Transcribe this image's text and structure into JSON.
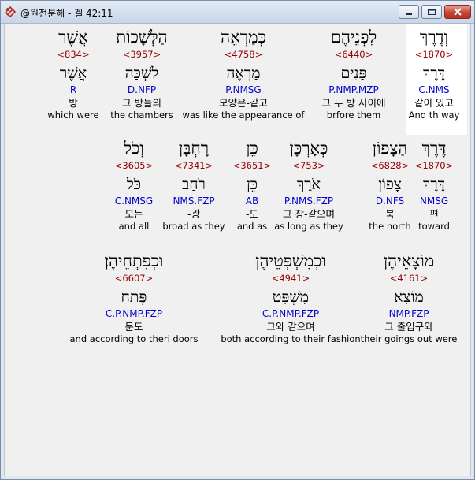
{
  "window": {
    "title": "@원전분해 - 겔 42:11",
    "colors": {
      "strong_number": "#990000",
      "morphology": "#0000cc",
      "highlight_bg": "#ffffff",
      "client_bg": "#f0f0f0"
    },
    "icons": [
      "app-icon",
      "minimize-icon",
      "maximize-icon",
      "close-icon"
    ]
  },
  "rows": [
    {
      "words": [
        {
          "hebrew": "וְדֶרֶךְ",
          "strong": "<1870>",
          "lemma": "דֶּרֶךְ",
          "morph": "C.NMS",
          "korean": "같이 있고",
          "english": "And th way",
          "highlighted": true
        },
        {
          "hebrew": "לִפְנֵיהֶם",
          "strong": "<6440>",
          "lemma": "פָּנִים",
          "morph": "P.NMP.MZP",
          "korean": "그 두 방 사이에",
          "english": "brfore them"
        },
        {
          "hebrew": "כְּמַרְאֵה",
          "strong": "<4758>",
          "lemma": "מַרְאֶה",
          "morph": "P.NMSG",
          "korean": "모양은-같고",
          "english": "was like the appearance of"
        },
        {
          "hebrew": "הַלְּשָׁכוֹת",
          "strong": "<3957>",
          "lemma": "לִשְׁכָּה",
          "morph": "D.NFP",
          "korean": "그 방들의",
          "english": "the chambers"
        },
        {
          "hebrew": "אֲשֶׁר",
          "strong": "<834>",
          "lemma": "אֲשֶׁר",
          "morph": "R",
          "korean": "방",
          "english": "which were"
        }
      ]
    },
    {
      "words": [
        {
          "hebrew": "דֶּרֶךְ",
          "strong": "<1870>",
          "lemma": "דֶּרֶךְ",
          "morph": "NMSG",
          "korean": "편",
          "english": "toward"
        },
        {
          "hebrew": "הַצָּפוֹן",
          "strong": "<6828>",
          "lemma": "צָפוֹן",
          "morph": "D.NFS",
          "korean": "북",
          "english": "the north"
        },
        {
          "hebrew": "כְּאָרְכָּן",
          "strong": "<753>",
          "lemma": "אֹרֶךְ",
          "morph": "P.NMS.FZP",
          "korean": "그 장-같으며",
          "english": "as long as they"
        },
        {
          "hebrew": "כֵּן",
          "strong": "<3651>",
          "lemma": "כֵּן",
          "morph": "AB",
          "korean": "-도",
          "english": "and as"
        },
        {
          "hebrew": "רָחְבָּן",
          "strong": "<7341>",
          "lemma": "רֹחַב",
          "morph": "NMS.FZP",
          "korean": "-광",
          "english": "broad as they"
        },
        {
          "hebrew": "וְכֹל",
          "strong": "<3605>",
          "lemma": "כֹּל",
          "morph": "C.NMSG",
          "korean": "모든",
          "english": "and all"
        }
      ]
    },
    {
      "words": [
        {
          "hebrew": "מוֹצָאֵיהֶן",
          "strong": "<4161>",
          "lemma": "מוֹצָא",
          "morph": "NMP.FZP",
          "korean": "그 출입구와",
          "english": "their goings out were"
        },
        {
          "hebrew": "וּכְמִשְׁפְּטֵיהֶן",
          "strong": "<4941>",
          "lemma": "מִשְׁפָּט",
          "morph": "C.P.NMP.FZP",
          "korean": "그와 같으며",
          "english": "both according to their fashion"
        },
        {
          "hebrew": "וּכְפִתְחֵיהֶן׃",
          "strong": "<6607>",
          "lemma": "פֶּתַח",
          "morph": "C.P.NMP.FZP",
          "korean": "문도",
          "english": "and according to theri doors"
        }
      ]
    }
  ]
}
